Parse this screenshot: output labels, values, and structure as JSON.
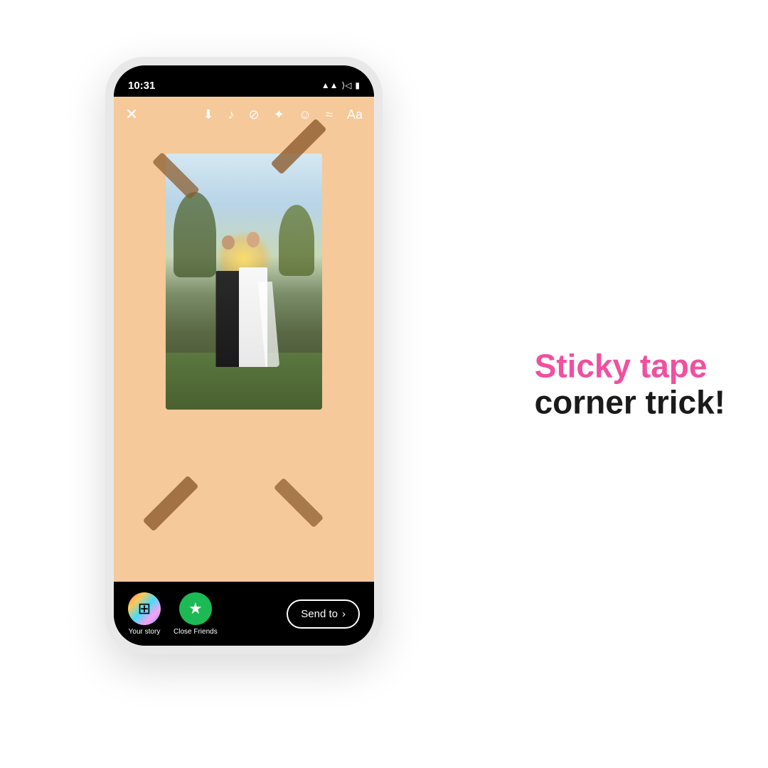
{
  "page": {
    "background": "#ffffff"
  },
  "phone": {
    "status_time": "10:31",
    "status_signal": "▲",
    "status_wifi": "⟩",
    "status_battery": "▮"
  },
  "toolbar": {
    "close_icon": "✕",
    "download_icon": "⬇",
    "music_icon": "♪",
    "link_icon": "⊘",
    "sparkle_icon": "✦",
    "emoji_icon": "☺",
    "audio_icon": "≈",
    "text_icon": "Aa"
  },
  "story": {
    "background_color": "#f5c99a"
  },
  "bottom_bar": {
    "your_story_label": "Your story",
    "close_friends_label": "Close Friends",
    "send_to_label": "Send to",
    "chevron": "›"
  },
  "text_overlay": {
    "line1": "Sticky tape",
    "line2": "corner trick!",
    "line1_color": "#f050a0",
    "line2_color": "#1a1a1a"
  }
}
